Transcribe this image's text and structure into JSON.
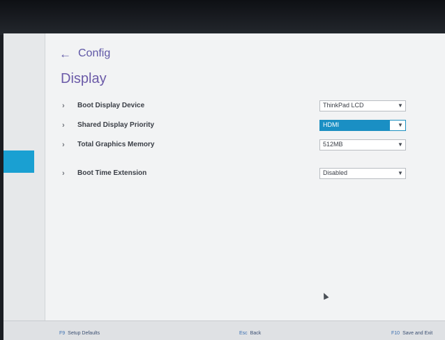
{
  "header": {
    "back_icon": "←",
    "breadcrumb": "Config",
    "title": "Display"
  },
  "settings": [
    {
      "label": "Boot Display Device",
      "value": "ThinkPad LCD"
    },
    {
      "label": "Shared Display Priority",
      "value": "HDMI"
    },
    {
      "label": "Total Graphics Memory",
      "value": "512MB"
    },
    {
      "label": "Boot Time Extension",
      "value": "Disabled"
    }
  ],
  "icons": {
    "chevron": "›",
    "caret": "▼"
  },
  "footer": [
    {
      "key": "F9",
      "label": "Setup Defaults"
    },
    {
      "key": "Esc",
      "label": "Back"
    },
    {
      "key": "F10",
      "label": "Save and Exit"
    }
  ],
  "colors": {
    "accent": "#1a8fc4",
    "title": "#6b5aa8"
  }
}
